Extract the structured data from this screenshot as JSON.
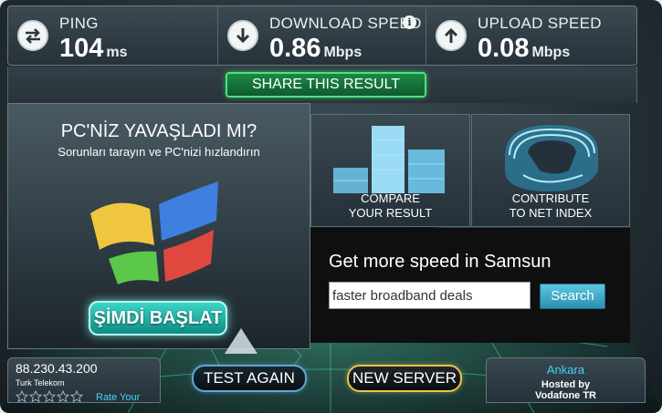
{
  "stats": {
    "ping": {
      "label": "PING",
      "value": "104",
      "unit": "ms",
      "icon": "ping-arrows-icon"
    },
    "download": {
      "label": "DOWNLOAD SPEED",
      "value": "0.86",
      "unit": "Mbps",
      "icon": "download-arrow-icon"
    },
    "upload": {
      "label": "UPLOAD SPEED",
      "value": "0.08",
      "unit": "Mbps",
      "icon": "upload-arrow-icon"
    }
  },
  "share_label": "SHARE THIS RESULT",
  "ad": {
    "title": "PC'NİZ YAVAŞLADI MI?",
    "subtitle": "Sorunları tarayın ve PC'nizi hızlandırın",
    "button": "ŞİMDİ BAŞLAT"
  },
  "tiles": {
    "compare": {
      "line1": "COMPARE",
      "line2": "YOUR RESULT"
    },
    "contribute": {
      "line1": "CONTRIBUTE",
      "line2": "TO NET INDEX"
    }
  },
  "search": {
    "title": "Get more speed in Samsun",
    "input_value": "faster broadband deals",
    "button": "Search"
  },
  "isp": {
    "ip": "88.230.43.200",
    "name": "Turk Telekom",
    "rate_label": "Rate Your",
    "stars_filled": 0,
    "stars_total": 5
  },
  "actions": {
    "test_again": "TEST AGAIN",
    "new_server": "NEW SERVER"
  },
  "server": {
    "city": "Ankara",
    "hosted_line1": "Hosted by",
    "hosted_line2": "Vodafone TR"
  },
  "colors": {
    "accent_green": "#47e57c",
    "accent_cyan": "#40d5f5",
    "accent_gold": "#e8c34a"
  }
}
